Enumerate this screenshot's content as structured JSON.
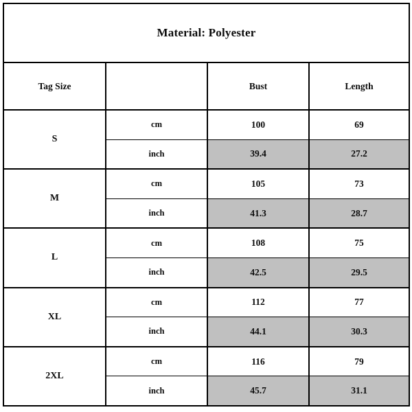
{
  "title": "Material: Polyester",
  "columns": {
    "tag_size": "Tag Size",
    "unit": "",
    "bust": "Bust",
    "length": "Length"
  },
  "units": {
    "cm": "cm",
    "inch": "inch"
  },
  "colors": {
    "shaded_cell": "#C0C0C0",
    "border": "#000000",
    "background": "#FFFFFF",
    "text": "#0B0B0B"
  },
  "chart_data": {
    "type": "table",
    "title": "Material: Polyester",
    "columns": [
      "Tag Size",
      "",
      "Bust",
      "Length"
    ],
    "rows": [
      {
        "size": "S",
        "unit": "cm",
        "bust": "100",
        "length": "69",
        "shaded": false
      },
      {
        "size": "S",
        "unit": "inch",
        "bust": "39.4",
        "length": "27.2",
        "shaded": true
      },
      {
        "size": "M",
        "unit": "cm",
        "bust": "105",
        "length": "73",
        "shaded": false
      },
      {
        "size": "M",
        "unit": "inch",
        "bust": "41.3",
        "length": "28.7",
        "shaded": true
      },
      {
        "size": "L",
        "unit": "cm",
        "bust": "108",
        "length": "75",
        "shaded": false
      },
      {
        "size": "L",
        "unit": "inch",
        "bust": "42.5",
        "length": "29.5",
        "shaded": true
      },
      {
        "size": "XL",
        "unit": "cm",
        "bust": "112",
        "length": "77",
        "shaded": false
      },
      {
        "size": "XL",
        "unit": "inch",
        "bust": "44.1",
        "length": "30.3",
        "shaded": true
      },
      {
        "size": "2XL",
        "unit": "cm",
        "bust": "116",
        "length": "79",
        "shaded": false
      },
      {
        "size": "2XL",
        "unit": "inch",
        "bust": "45.7",
        "length": "31.1",
        "shaded": true
      }
    ]
  },
  "sizes": [
    {
      "label": "S",
      "cm": {
        "unit": "cm",
        "bust": "100",
        "length": "69"
      },
      "inch": {
        "unit": "inch",
        "bust": "39.4",
        "length": "27.2"
      }
    },
    {
      "label": "M",
      "cm": {
        "unit": "cm",
        "bust": "105",
        "length": "73"
      },
      "inch": {
        "unit": "inch",
        "bust": "41.3",
        "length": "28.7"
      }
    },
    {
      "label": "L",
      "cm": {
        "unit": "cm",
        "bust": "108",
        "length": "75"
      },
      "inch": {
        "unit": "inch",
        "bust": "42.5",
        "length": "29.5"
      }
    },
    {
      "label": "XL",
      "cm": {
        "unit": "cm",
        "bust": "112",
        "length": "77"
      },
      "inch": {
        "unit": "inch",
        "bust": "44.1",
        "length": "30.3"
      }
    },
    {
      "label": "2XL",
      "cm": {
        "unit": "cm",
        "bust": "116",
        "length": "79"
      },
      "inch": {
        "unit": "inch",
        "bust": "45.7",
        "length": "31.1"
      }
    }
  ]
}
